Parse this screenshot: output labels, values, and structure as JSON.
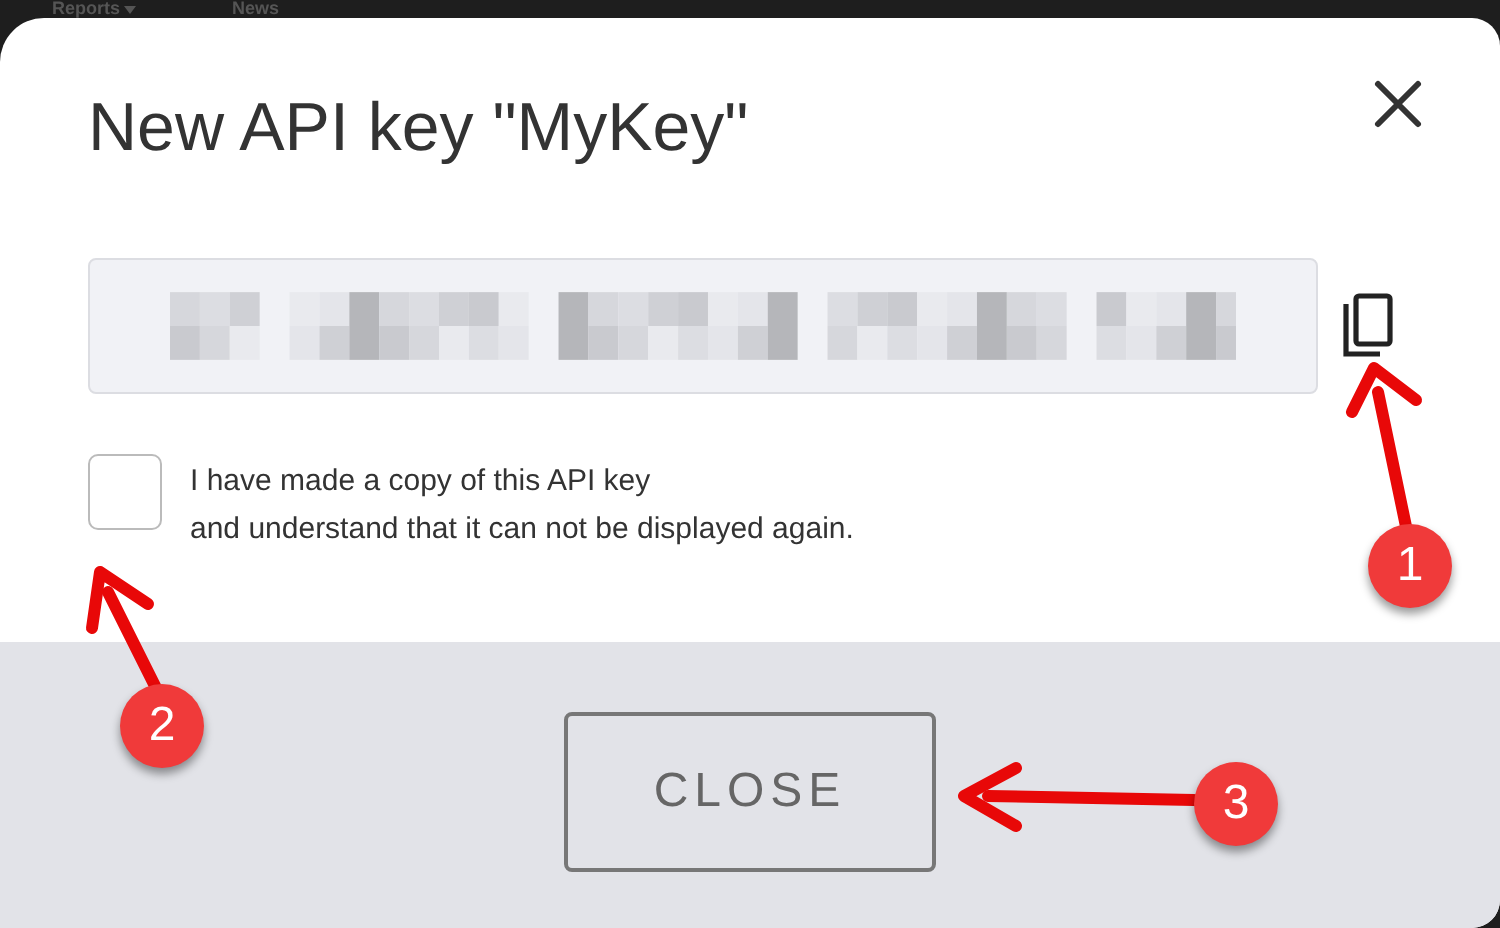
{
  "nav": [
    {
      "label": "Reports",
      "kind": "dropdown"
    },
    {
      "label": "News",
      "kind": "link"
    }
  ],
  "dialog": {
    "title": "New API key \"MyKey\"",
    "confirm_checkbox": {
      "checked": false,
      "label_lines": [
        "I have made a copy of this API key",
        "and understand that it can not be displayed again."
      ]
    },
    "close_button": "CLOSE"
  },
  "annotations": [
    {
      "number": "1"
    },
    {
      "number": "2"
    },
    {
      "number": "3"
    }
  ]
}
